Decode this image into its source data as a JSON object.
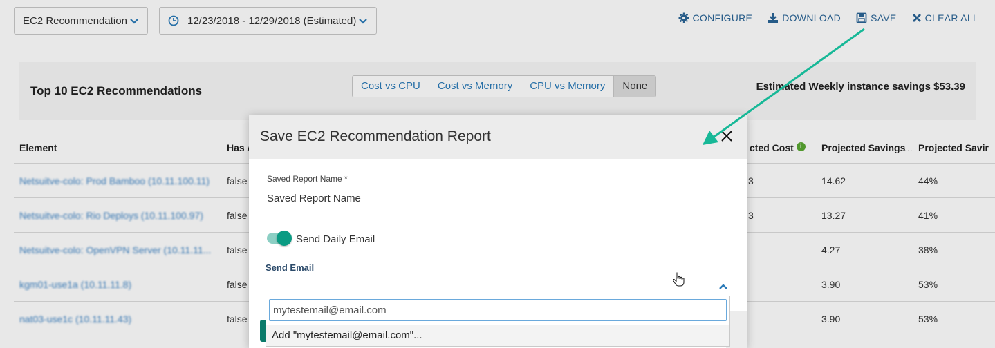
{
  "toolbar": {
    "report_select": "EC2 Recommendation",
    "date_range": "12/23/2018 - 12/29/2018 (Estimated)",
    "actions": [
      {
        "label": "CONFIGURE",
        "icon": "gear-icon"
      },
      {
        "label": "DOWNLOAD",
        "icon": "download-icon"
      },
      {
        "label": "SAVE",
        "icon": "floppy-disk-icon"
      },
      {
        "label": "CLEAR ALL",
        "icon": "x-icon"
      }
    ]
  },
  "panel": {
    "title": "Top 10 EC2 Recommendations",
    "segments": [
      "Cost vs CPU",
      "Cost vs Memory",
      "CPU vs Memory",
      "None"
    ],
    "selected_segment": "None",
    "savings": "Estimated Weekly instance savings $53.39"
  },
  "table": {
    "headers": [
      "Element",
      "Has A",
      "cted Cost",
      "Projected Savings",
      "...",
      "Projected Savir"
    ],
    "rows": [
      {
        "element": "Netsuitve-colo: Prod Bamboo (10.11.100.11)",
        "has": "false",
        "cost": "3",
        "savings": "14.62",
        "pct": "44%"
      },
      {
        "element": "Netsuitve-colo: Rio Deploys (10.11.100.97)",
        "has": "false",
        "cost": "3",
        "savings": "13.27",
        "pct": "41%"
      },
      {
        "element": "Netsuitve-colo: OpenVPN Server (10.11.11...",
        "has": "false",
        "cost": "",
        "savings": "4.27",
        "pct": "38%"
      },
      {
        "element": "kgm01-use1a (10.11.11.8)",
        "has": "false",
        "cost": "",
        "savings": "3.90",
        "pct": "53%"
      },
      {
        "element": "nat03-use1c (10.11.11.43)",
        "has": "false",
        "cost": "",
        "savings": "3.90",
        "pct": "53%"
      }
    ]
  },
  "modal": {
    "title": "Save EC2 Recommendation Report",
    "name_label": "Saved Report Name *",
    "name_value": "Saved Report Name",
    "toggle_label": "Send Daily Email",
    "toggle_on": true,
    "send_email_label": "Send Email",
    "email_value": "mytestemail@email.com",
    "add_option": "Add \"mytestemail@email.com\"..."
  },
  "colors": {
    "accent": "#2a7ab8",
    "toggle": "#0a9b83",
    "arrow": "#17b897",
    "info": "#5aa832"
  }
}
